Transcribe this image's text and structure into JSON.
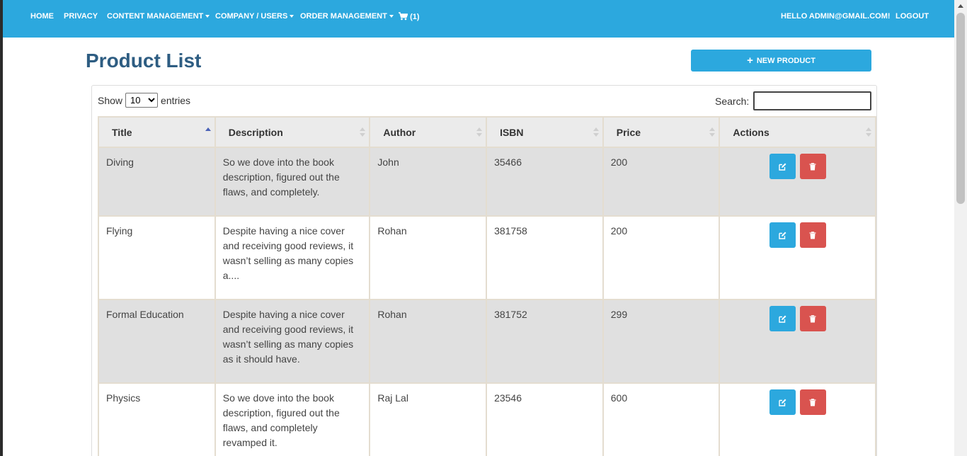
{
  "nav": {
    "home": "HOME",
    "privacy": "PRIVACY",
    "content_management": "CONTENT MANAGEMENT",
    "company_users": "COMPANY / USERS",
    "order_management": "ORDER MANAGEMENT",
    "cart_count": "(1)",
    "greeting": "HELLO ADMIN@GMAIL.COM!",
    "logout": "LOGOUT"
  },
  "page": {
    "title": "Product List",
    "new_button": "NEW PRODUCT"
  },
  "table_controls": {
    "show_label": "Show",
    "entries_value": "10",
    "entries_label": "entries",
    "search_label": "Search:"
  },
  "columns": [
    "Title",
    "Description",
    "Author",
    "ISBN",
    "Price",
    "Actions"
  ],
  "rows": [
    {
      "title": "Diving",
      "description": "So we dove into the book description, figured out the flaws, and completely.",
      "author": "John",
      "isbn": "35466",
      "price": "200"
    },
    {
      "title": "Flying",
      "description": "Despite having a nice cover and receiving good reviews, it wasn’t selling as many copies a....",
      "author": "Rohan",
      "isbn": "381758",
      "price": "200"
    },
    {
      "title": "Formal Education",
      "description": "Despite having a nice cover and receiving good reviews, it wasn’t selling as many copies as it should have.",
      "author": "Rohan",
      "isbn": "381752",
      "price": "299"
    },
    {
      "title": "Physics",
      "description": "So we dove into the book description, figured out the flaws, and completely revamped it.",
      "author": "Raj Lal",
      "isbn": "23546",
      "price": "600"
    }
  ],
  "colors": {
    "primary": "#2ca8de",
    "danger": "#d9534f",
    "title": "#2e5d82"
  },
  "icons": {
    "cart": "shopping-cart-icon",
    "edit": "edit-icon",
    "delete": "trash-icon",
    "add": "plus-icon"
  }
}
